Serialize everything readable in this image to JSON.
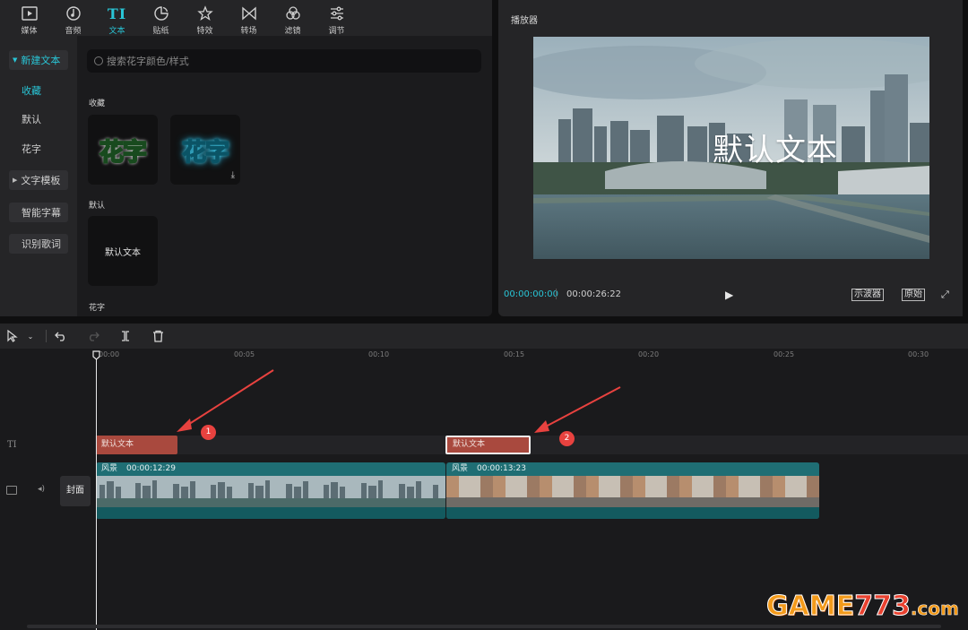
{
  "media_panel": {
    "tabs": [
      {
        "label": "媒体",
        "icon": "media-icon"
      },
      {
        "label": "音频",
        "icon": "audio-icon"
      },
      {
        "label": "文本",
        "icon": "text-icon"
      },
      {
        "label": "贴纸",
        "icon": "sticker-icon"
      },
      {
        "label": "特效",
        "icon": "effects-icon"
      },
      {
        "label": "转场",
        "icon": "transition-icon"
      },
      {
        "label": "滤镜",
        "icon": "filter-icon"
      },
      {
        "label": "调节",
        "icon": "adjust-icon"
      }
    ],
    "active_tab_glyph": "TI",
    "side_nav": {
      "new_text": "新建文本",
      "favorites": "收藏",
      "default": "默认",
      "fancy": "花字",
      "text_template": "文字模板",
      "smart_subtitles": "智能字幕",
      "recognize_lyrics": "识别歌词"
    },
    "search_placeholder": "搜索花字颜色/样式",
    "sections": {
      "favorites": "收藏",
      "default": "默认",
      "fancy": "花字"
    },
    "cards": {
      "fancy_green": "花字",
      "fancy_blue": "花字",
      "default_text": "默认文本"
    }
  },
  "player": {
    "title": "播放器",
    "overlay_text": "默认文本",
    "current_time": "00:00:00:00",
    "total_time": "00:00:26:22",
    "scope_button": "示波器",
    "original_button": "原始"
  },
  "timeline": {
    "ruler_labels": [
      "00:00",
      "00:05",
      "00:10",
      "00:15",
      "00:20",
      "00:25",
      "00:30"
    ],
    "track_icons": {
      "text": "TI"
    },
    "cover_label": "封面",
    "text_clips": [
      {
        "label": "默认文本"
      },
      {
        "label": "默认文本"
      }
    ],
    "video_clips": [
      {
        "name": "风景",
        "duration": "00:00:12:29"
      },
      {
        "name": "风景",
        "duration": "00:00:13:23"
      }
    ],
    "markers": [
      "1",
      "2"
    ]
  },
  "watermark": {
    "main": "GAME",
    "num": "773",
    "domain": ".com"
  },
  "colors": {
    "accent": "#29c5d6",
    "text_clip": "#a9493e",
    "video_clip": "#1f6e74",
    "marker": "#e8423f"
  }
}
